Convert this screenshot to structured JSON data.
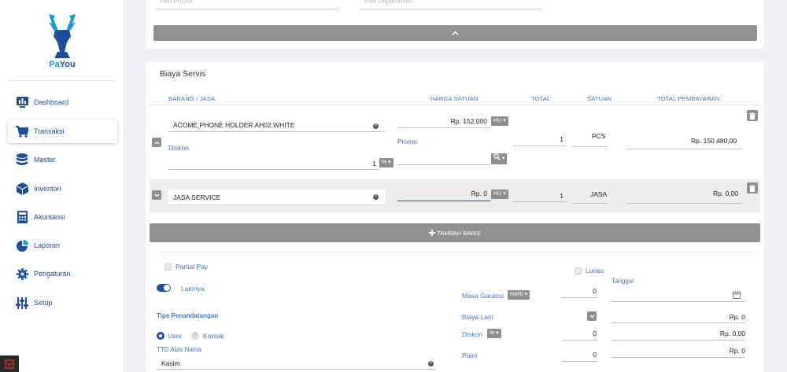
{
  "app": {
    "brand_prefix": "Pa",
    "brand_suffix": "You"
  },
  "sidebar": {
    "items": [
      {
        "label": "Dashboard",
        "icon": "dashboard-icon"
      },
      {
        "label": "Transaksi",
        "icon": "cart-icon",
        "active": true
      },
      {
        "label": "Master",
        "icon": "database-icon"
      },
      {
        "label": "Inventori",
        "icon": "box-icon"
      },
      {
        "label": "Akuntansi",
        "icon": "calculator-icon"
      },
      {
        "label": "Laporan",
        "icon": "pie-chart-icon"
      },
      {
        "label": "Pengaturan",
        "icon": "gear-icon"
      },
      {
        "label": "Setup",
        "icon": "sliders-icon"
      }
    ]
  },
  "top_card": {
    "proyek_placeholder": "Pilih Proyek",
    "departemen_placeholder": "Pilih Departemen"
  },
  "biaya": {
    "title": "Biaya Servis",
    "headers": {
      "barang": "BARANG / JASA",
      "harga": "HARGA SATUAN",
      "total": "TOTAL",
      "satuan": "SATUAN",
      "pembayaran": "TOTAL PEMBAYARAN"
    },
    "rows": [
      {
        "item": "ACOME,PHONE HOLDER AH02,WHITE",
        "harga": "Rp. 152.000",
        "unit_dd": "HU",
        "qty": "1",
        "satuan": "PCS",
        "total": "Rp. 150.480,00",
        "diskon_label": "Diskon",
        "diskon_value": "1",
        "diskon_dd": "%",
        "promo_label": "Promo"
      },
      {
        "item": "JASA SERVICE",
        "harga": "Rp. 0",
        "unit_dd": "HU",
        "qty": "1",
        "satuan": "JASA",
        "total": "Rp. 0,00"
      }
    ],
    "add_row": "TAMBAH BARIS"
  },
  "footer": {
    "partial_pay": "Partial Pay",
    "lainnya": "Lainnya",
    "tipe_label": "Tipe Penandatangan",
    "opt_user": "User",
    "opt_kontak": "Kontak",
    "ttd_label": "TTD Atas Nama",
    "ttd_value": "Kasim",
    "lunas": "Lunas",
    "tanggal": "Tanggal",
    "masa_garansi": "Masa Garansi",
    "masa_dd": "HARI",
    "masa_value": "0",
    "biaya_lain": "Biaya Lain",
    "biaya_lain_value": "Rp. 0",
    "diskon": "Diskon",
    "diskon_dd": "%",
    "diskon_pct": "0",
    "diskon_value": "Rp. 0,00",
    "point": "Point",
    "point_qty": "0",
    "point_value": "Rp. 0"
  }
}
